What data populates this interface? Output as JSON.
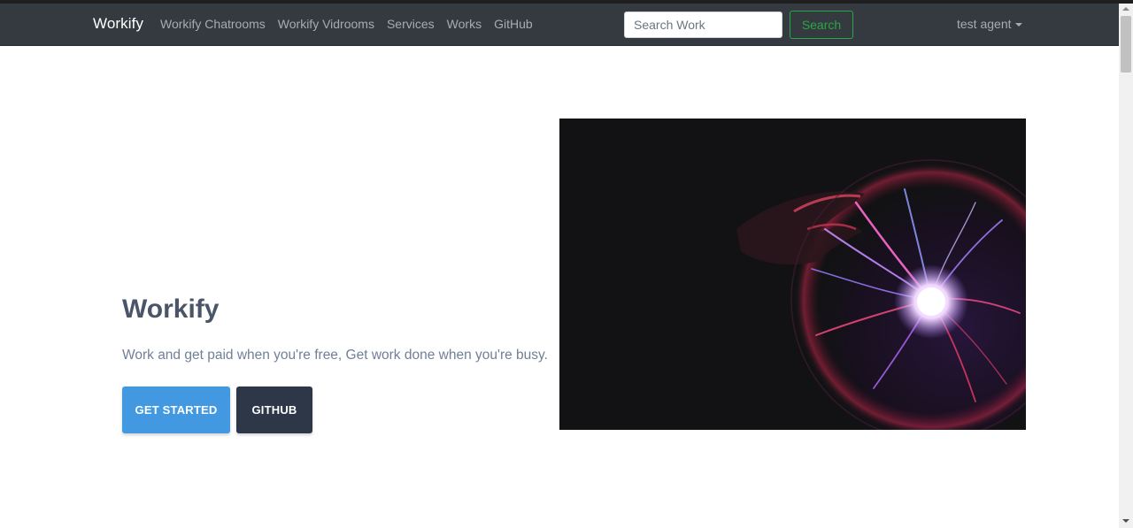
{
  "navbar": {
    "brand": "Workify",
    "links": [
      {
        "label": "Workify Chatrooms"
      },
      {
        "label": "Workify Vidrooms"
      },
      {
        "label": "Services"
      },
      {
        "label": "Works"
      },
      {
        "label": "GitHub"
      }
    ],
    "search": {
      "placeholder": "Search Work",
      "value": "",
      "button_label": "Search"
    },
    "user": {
      "name": "test agent",
      "icon": "caret-down-icon"
    }
  },
  "hero": {
    "title": "Workify",
    "subtitle": "Work and get paid when you're free, Get work done when you're busy.",
    "primary_button": "GET STARTED",
    "secondary_button": "GITHUB",
    "image": {
      "subject": "plasma-ball-photo"
    }
  },
  "colors": {
    "navbar_bg": "#343a40",
    "primary": "#4299e1",
    "dark_button": "#2d3748",
    "search_green": "#28a745",
    "heading": "#4a5568",
    "text_muted": "#718096"
  }
}
